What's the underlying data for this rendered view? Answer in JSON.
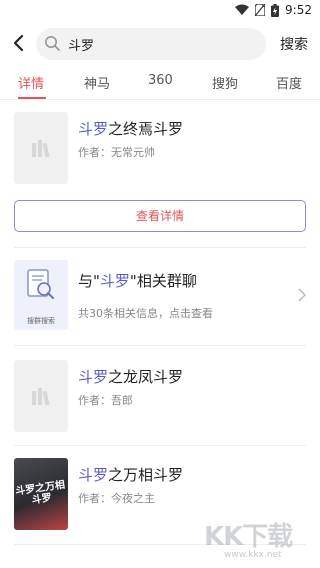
{
  "status_bar": {
    "time": "9:52"
  },
  "search": {
    "query": "斗罗",
    "button_label": "搜索"
  },
  "tabs": [
    {
      "label": "详情",
      "active": true
    },
    {
      "label": "神马",
      "active": false
    },
    {
      "label": "360",
      "active": false
    },
    {
      "label": "搜狗",
      "active": false
    },
    {
      "label": "百度",
      "active": false
    }
  ],
  "results": [
    {
      "title_highlight": "斗罗",
      "title_rest": "之终焉斗罗",
      "meta": "作者：无常元帅"
    },
    {
      "title_highlight": "斗罗",
      "title_rest": "之龙凤斗罗",
      "meta": "作者：吾郎"
    },
    {
      "title_highlight": "斗罗",
      "title_rest": "之万相斗罗",
      "meta": "作者：今夜之主"
    }
  ],
  "detail_button_label": "查看详情",
  "group_chat": {
    "prefix": "与\"",
    "highlight": "斗罗",
    "suffix": "\"相关群聊",
    "meta": "共30条相关信息，点击查看",
    "icon_label": "搜群搜索"
  },
  "cover_art_text": "斗罗之万相斗罗",
  "watermark": {
    "text": "KK下载",
    "url": "www.kkx.net"
  },
  "colors": {
    "accent_red": "#e05555",
    "highlight_blue": "#5a5ad0"
  }
}
